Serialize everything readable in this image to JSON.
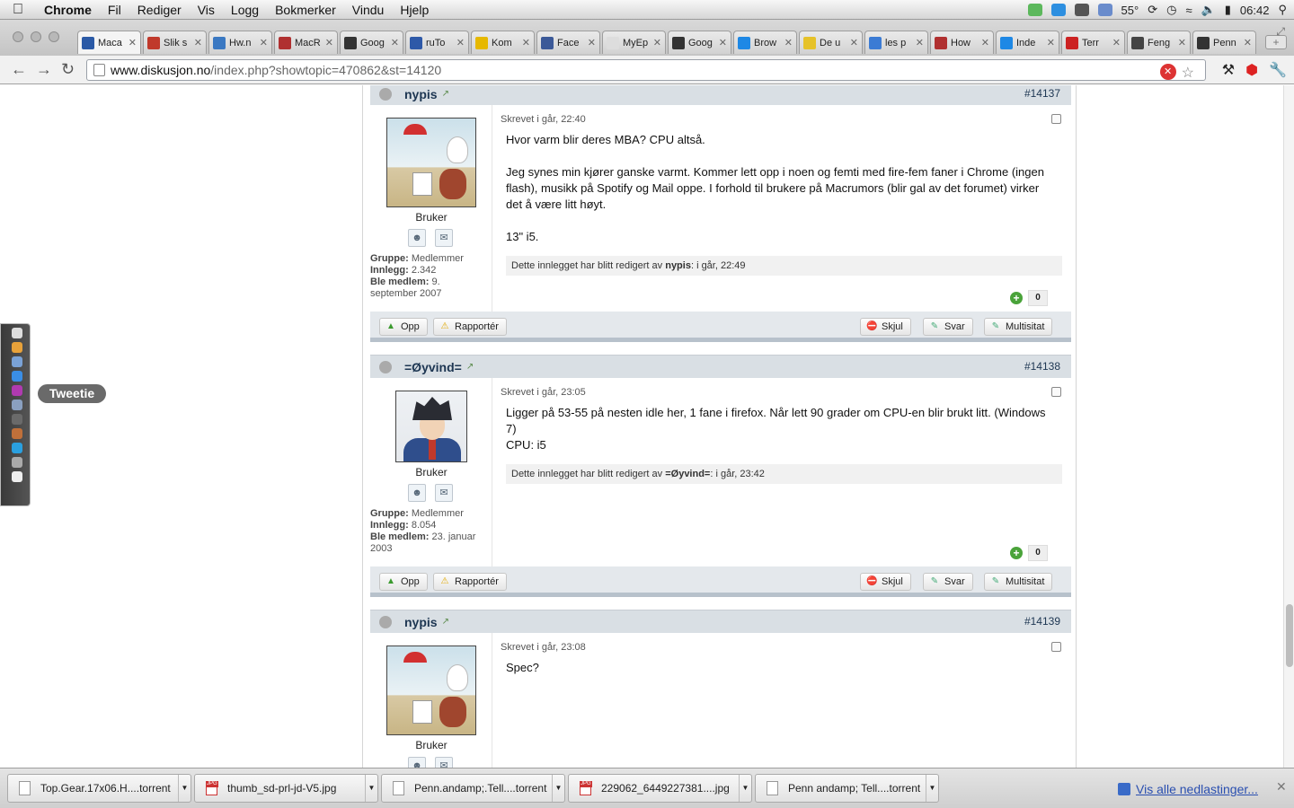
{
  "menubar": {
    "app": "Chrome",
    "items": [
      "Fil",
      "Rediger",
      "Vis",
      "Logg",
      "Bokmerker",
      "Vindu",
      "Hjelp"
    ],
    "temperature": "55°",
    "time": "06:42"
  },
  "tabs": [
    {
      "label": "Maca",
      "color": "#2b5aa6"
    },
    {
      "label": "Slik s",
      "color": "#c0392b"
    },
    {
      "label": "Hw.n",
      "color": "#3a78c2"
    },
    {
      "label": "MacR",
      "color": "#b03030"
    },
    {
      "label": "Goog",
      "color": "#333333"
    },
    {
      "label": "ruTo",
      "color": "#2e59a8"
    },
    {
      "label": "Kom",
      "color": "#e6b800"
    },
    {
      "label": "Face",
      "color": "#3b5998"
    },
    {
      "label": "MyEp",
      "color": "#dddddd"
    },
    {
      "label": "Goog",
      "color": "#333333"
    },
    {
      "label": "Brow",
      "color": "#1e88e5"
    },
    {
      "label": "De u",
      "color": "#e6c229"
    },
    {
      "label": "les p",
      "color": "#3b7bd4"
    },
    {
      "label": "How",
      "color": "#b03030"
    },
    {
      "label": "Inde",
      "color": "#1e88e5"
    },
    {
      "label": "Terr",
      "color": "#cc2222"
    },
    {
      "label": "Feng",
      "color": "#444444"
    },
    {
      "label": "Penn",
      "color": "#333333"
    }
  ],
  "omnibox": {
    "domain": "www.diskusjon.no",
    "path": "/index.php?showtopic=470862&st=14120"
  },
  "posts": [
    {
      "author": "nypis",
      "number": "#14137",
      "rank": "Bruker",
      "group_label": "Gruppe:",
      "group": "Medlemmer",
      "posts_label": "Innlegg:",
      "posts": "2.342",
      "joined_label": "Ble medlem:",
      "joined": "9. september 2007",
      "date": "Skrevet i går, 22:40",
      "text": "Hvor varm blir deres MBA? CPU altså.\n\nJeg synes min kjører ganske varmt. Kommer lett opp i noen og femti med fire-fem faner i Chrome (ingen flash), musikk på Spotify og Mail oppe. I forhold til brukere på Macrumors (blir gal av det forumet) virker det å være litt høyt.\n\n13\" i5.",
      "edited_prefix": "Dette innlegget har blitt redigert av",
      "edited_by": "nypis",
      "edited_time": ": i går, 22:49",
      "reputation": "0"
    },
    {
      "author": "=Øyvind=",
      "number": "#14138",
      "rank": "Bruker",
      "group_label": "Gruppe:",
      "group": "Medlemmer",
      "posts_label": "Innlegg:",
      "posts": "8.054",
      "joined_label": "Ble medlem:",
      "joined": "23. januar 2003",
      "date": "Skrevet i går, 23:05",
      "text": "Ligger på 53-55 på nesten idle her, 1 fane i firefox. Når lett 90 grader om CPU-en blir brukt litt. (Windows 7)\nCPU: i5",
      "edited_prefix": "Dette innlegget har blitt redigert av",
      "edited_by": "=Øyvind=",
      "edited_time": ": i går, 23:42",
      "reputation": "0"
    },
    {
      "author": "nypis",
      "number": "#14139",
      "rank": "Bruker",
      "date": "Skrevet i går, 23:08",
      "text": "Spec?"
    }
  ],
  "footer_buttons": {
    "up": "Opp",
    "report": "Rapportér",
    "hide": "Skjul",
    "reply": "Svar",
    "multiquote": "Multisitat"
  },
  "tweetie": "Tweetie",
  "downloads": [
    {
      "name": "Top.Gear.17x06.H....torrent",
      "type": "file"
    },
    {
      "name": "thumb_sd-prl-jd-V5.jpg",
      "type": "jpg"
    },
    {
      "name": "Penn.andamp;.Tell....torrent",
      "type": "file"
    },
    {
      "name": "229062_6449227381....jpg",
      "type": "jpg"
    },
    {
      "name": "Penn andamp; Tell....torrent",
      "type": "file"
    }
  ],
  "show_all_downloads": "Vis alle nedlastinger..."
}
